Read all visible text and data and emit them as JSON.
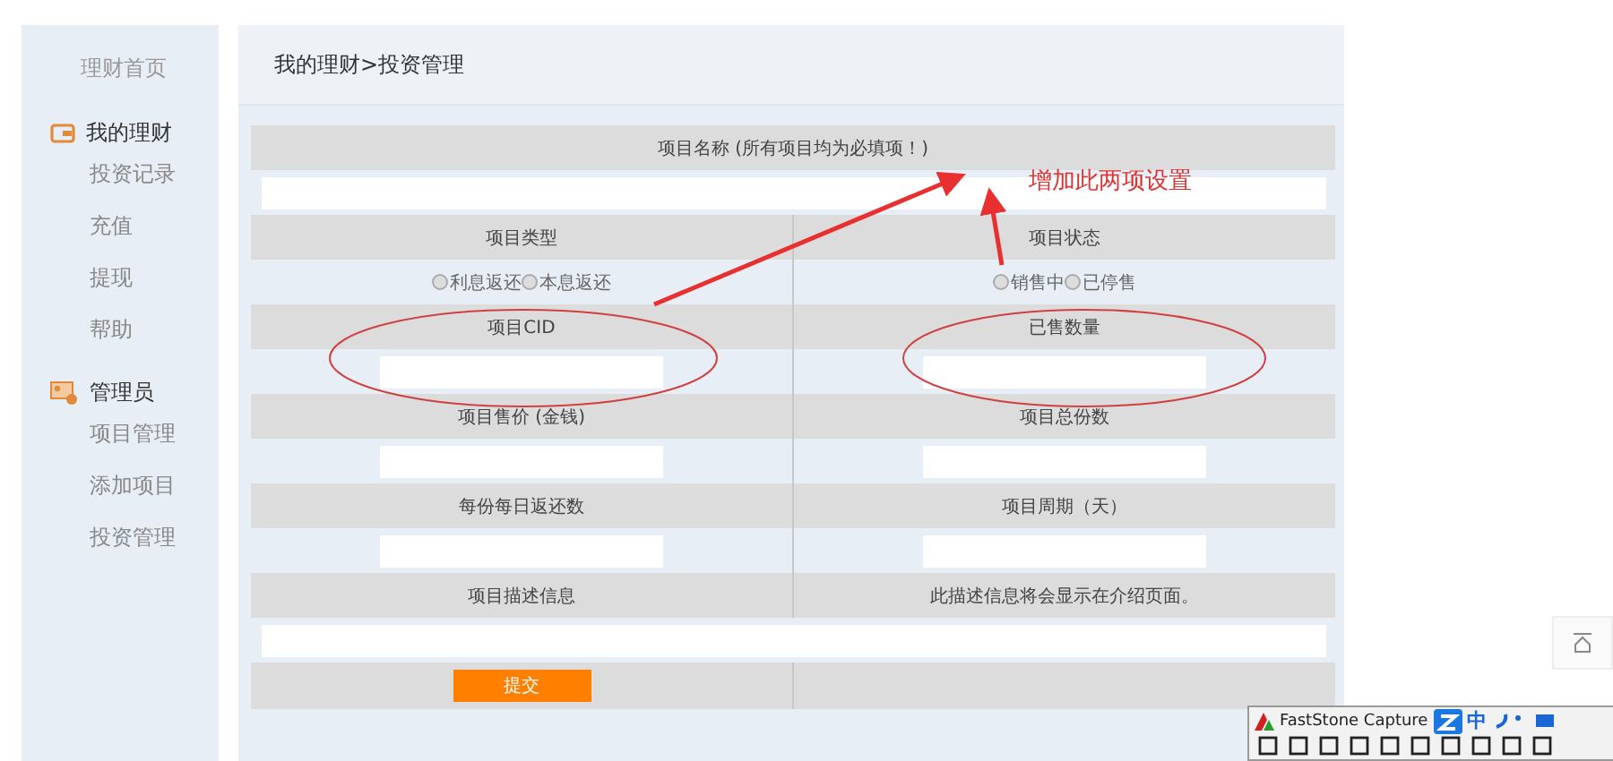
{
  "sidebar": {
    "home": "理财首页",
    "sections": [
      {
        "title": "我的理财",
        "kind": "wallet",
        "items": [
          "投资记录",
          "充值",
          "提现",
          "帮助"
        ]
      },
      {
        "title": "管理员",
        "kind": "admin",
        "items": [
          "项目管理",
          "添加项目",
          "投资管理"
        ]
      }
    ]
  },
  "breadcrumb": "我的理财>投资管理",
  "form": {
    "rows": [
      {
        "kind": "full_header",
        "label": "项目名称 (所有项目均为必填项！)"
      },
      {
        "kind": "full_input"
      },
      {
        "kind": "pair_header",
        "cells": [
          "项目类型",
          "项目状态"
        ]
      },
      {
        "kind": "pair_radio",
        "groups": [
          [
            {
              "label": "利息返还",
              "checked": false
            },
            {
              "label": "本息返还",
              "checked": false
            }
          ],
          [
            {
              "label": "销售中",
              "checked": false
            },
            {
              "label": "已停售",
              "checked": false
            }
          ]
        ]
      },
      {
        "kind": "pair_header",
        "cells": [
          "项目CID",
          "已售数量"
        ]
      },
      {
        "kind": "pair_input"
      },
      {
        "kind": "pair_header",
        "cells": [
          "项目售价 (金钱)",
          "项目总份数"
        ]
      },
      {
        "kind": "pair_input"
      },
      {
        "kind": "pair_header",
        "cells": [
          "每份每日返还数",
          "项目周期（天）"
        ]
      },
      {
        "kind": "pair_input"
      },
      {
        "kind": "pair_header",
        "cells": [
          "项目描述信息",
          "此描述信息将会显示在介绍页面。"
        ]
      },
      {
        "kind": "full_input"
      },
      {
        "kind": "submit",
        "label": "提交"
      }
    ]
  },
  "annotation": {
    "note": "增加此两项设置"
  },
  "capture_bar": {
    "title": "FastStone Capture",
    "ime": "中"
  }
}
